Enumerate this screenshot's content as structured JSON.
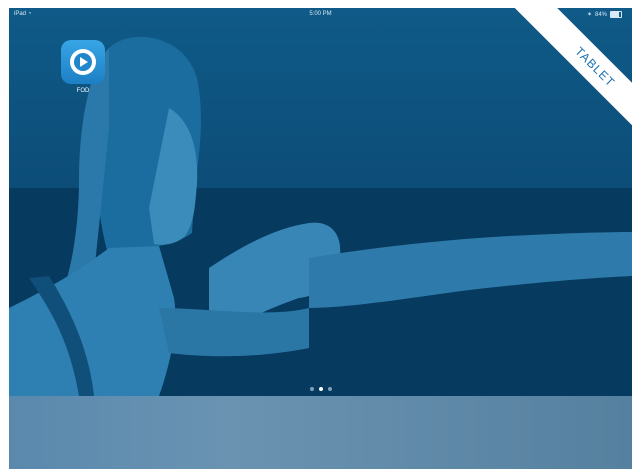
{
  "status_bar": {
    "device": "iPad",
    "time": "5:00 PM",
    "battery": "84%",
    "battery_level": 0.84
  },
  "home_screen": {
    "apps": [
      {
        "label": "FOD",
        "icon": "play-icon"
      }
    ],
    "page_dots": {
      "count": 3,
      "active_index": 1
    }
  },
  "ribbon": {
    "label": "TABLET"
  },
  "colors": {
    "wallpaper": "#0d4f7b",
    "app_icon": "#2d95d8",
    "dock": "#5f8aab",
    "ribbon_text": "#1b6fb0"
  }
}
